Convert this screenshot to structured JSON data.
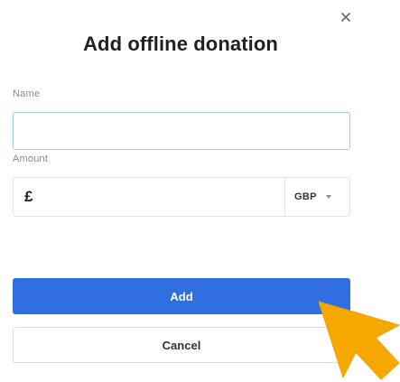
{
  "dialog": {
    "title": "Add offline donation",
    "close_icon": "close-icon"
  },
  "form": {
    "name_label": "Name",
    "name_value": "",
    "amount_label": "Amount",
    "amount_value": "",
    "currency_symbol": "£",
    "currency_code": "GBP",
    "currency_caret_icon": "chevron-down-icon"
  },
  "actions": {
    "add_label": "Add",
    "cancel_label": "Cancel"
  },
  "colors": {
    "primary": "#2f6fe0",
    "cursor": "#f7a800"
  },
  "overlay": {
    "pointer_icon": "cursor-arrow-icon"
  }
}
